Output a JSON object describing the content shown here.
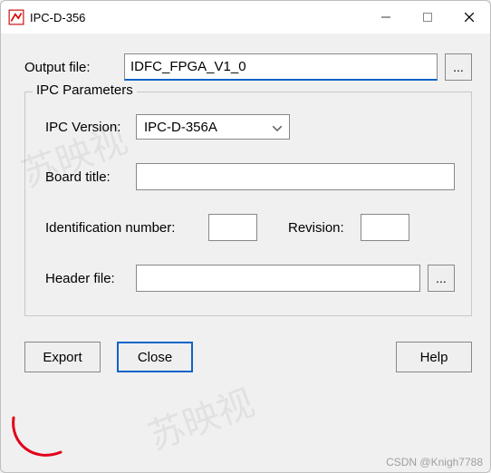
{
  "window": {
    "title": "IPC-D-356",
    "minimize": "–",
    "maximize": "☐",
    "close": "✕"
  },
  "output": {
    "label": "Output file:",
    "value": "IDFC_FPGA_V1_0",
    "browse": "..."
  },
  "group": {
    "title": "IPC Parameters",
    "version_label": "IPC Version:",
    "version_value": "IPC-D-356A",
    "board_title_label": "Board title:",
    "board_title_value": "",
    "ident_label": "Identification number:",
    "ident_value": "",
    "revision_label": "Revision:",
    "revision_value": "",
    "header_label": "Header file:",
    "header_value": "",
    "header_browse": "..."
  },
  "buttons": {
    "export": "Export",
    "close": "Close",
    "help": "Help"
  },
  "watermark": "苏映视",
  "credit": "CSDN @Knigh7788"
}
